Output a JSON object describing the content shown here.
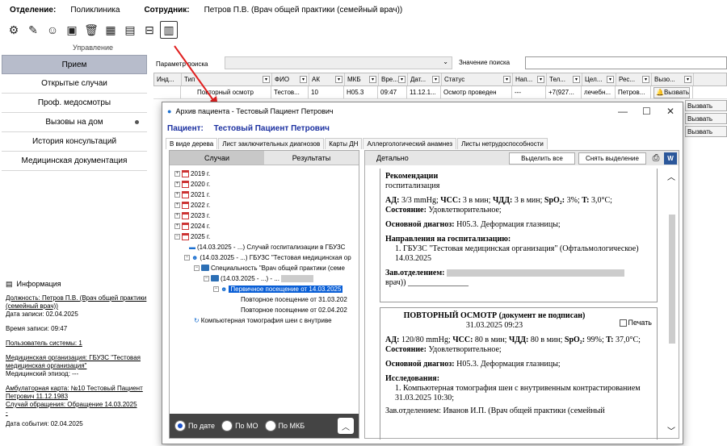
{
  "top": {
    "dept_label": "Отделение:",
    "dept_value": "Поликлиника",
    "emp_label": "Сотрудник:",
    "emp_value": "Петров П.В. (Врач общей практики (семейный врач))"
  },
  "toolbar": {
    "caption": "Управление"
  },
  "nav": [
    "Прием",
    "Открытые случаи",
    "Проф. медосмотры",
    "Вызовы на дом",
    "История консультаций",
    "Медицинская документация"
  ],
  "info": {
    "title": "Информация",
    "position": "Должность: Петров П.В. (Врач общей практики (семейный врач))",
    "record_date": "Дата записи: 02.04.2025",
    "record_time": "Время записи: 09:47",
    "sys_user": "Пользователь системы: 1",
    "org": "Медицинская организация: ГБУЗС \"Тестовая медицинская организация\"",
    "episode": "Медицинский эпизод: ---",
    "card": "Амбулаторная карта: №10 Тестовый Пациент Петрович 11.12.1983",
    "case": "Случай обращения: Обращение 14.03.2025",
    "dash": "-",
    "event_date": "Дата события: 02.04.2025"
  },
  "search": {
    "param_label": "Параметр поиска",
    "value_label": "Значение поиска"
  },
  "grid": {
    "headers": [
      "Инд...",
      "Тип",
      "ФИО",
      "АК",
      "МКБ",
      "Вре...",
      "Дат...",
      "Статус",
      "Нап...",
      "Тел...",
      "Цел...",
      "Рес...",
      "Вызо..."
    ],
    "row": [
      "",
      "Повторный осмотр",
      "Тестов...",
      "10",
      "H05.3",
      "09:47",
      "11.12.1...",
      "Осмотр проведен",
      "---",
      "+7(927...",
      "лечебн...",
      "Петров...",
      "Вызвать"
    ],
    "call_label": "Вызвать"
  },
  "modal": {
    "title": "Архив пациента - Тестовый Пациент Петрович",
    "patient_label": "Пациент:",
    "patient_name": "Тестовый Пациент Петрович",
    "tabs": [
      "В виде дерева",
      "Лист заключительных диагнозов",
      "Карты ДН",
      "Аллергологический анамнез",
      "Листы нетрудоспособности"
    ],
    "left_tabs": [
      "Случаи",
      "Результаты"
    ],
    "tree": {
      "y2019": "2019 г.",
      "y2020": "2020 г.",
      "y2021": "2021 г.",
      "y2022": "2022 г.",
      "y2023": "2023 г.",
      "y2024": "2024 г.",
      "y2025": "2025 г.",
      "n1": "(14.03.2025 - ...) Случай госпитализации в ГБУЗС",
      "n2": "(14.03.2025 - ...) ГБУЗС \"Тестовая медицинская ор",
      "n3": "Специальность \"Врач общей практики (семе",
      "n4": "(14.03.2025 - ...) - ...",
      "n5": "Первичное посещение от 14.03.2025",
      "n6": "Повторное посещение от 31.03.202",
      "n7": "Повторное посещение от 02.04.202",
      "n8": "Компьютерная томография шеи с внутриве"
    },
    "radios": [
      "По дате",
      "По МО",
      "По МКБ"
    ],
    "right_title": "Детально",
    "btn_select_all": "Выделить все",
    "btn_deselect": "Снять выделение",
    "doc1": {
      "rec_title": "Рекомендации",
      "rec_value": "госпитализация",
      "vitals_html_1": "АД:",
      "vitals_1": "3/3 mmHg;",
      "chss": "ЧСС:",
      "chss_v": "3 в мин;",
      "chdd": "ЧДД:",
      "chdd_v": "3 в мин;",
      "spo2": "SpO₂:",
      "spo2_v": "3%;",
      "t": "T:",
      "t_v": "3,0°C;",
      "state": "Состояние:",
      "state_v": "Удовлетворительное;",
      "diag": "Основной диагноз:",
      "diag_v": "H05.3. Деформация глазницы;",
      "refs": "Направления на госпитализацию:",
      "ref1": "1. ГБУЗС \"Тестовая медицинская организация\" (Офтальмологическое) 14.03.2025",
      "head": "Зав.отделением:",
      "doc_tail": "врач)) _______________"
    },
    "doc2": {
      "title": "ПОВТОРНЫЙ ОСМОТР (документ не подписан)",
      "date": "31.03.2025 09:23",
      "print": "Печать",
      "ad": "АД:",
      "ad_v": "120/80 mmHg;",
      "chss": "ЧСС:",
      "chss_v": "80 в мин;",
      "chdd": "ЧДД:",
      "chdd_v": "80 в мин;",
      "spo2": "SpO₂:",
      "spo2_v": "99%;",
      "t": "T:",
      "t_v": "37,0°C;",
      "state": "Состояние:",
      "state_v": "Удовлетворительное;",
      "diag": "Основной диагноз:",
      "diag_v": "H05.3. Деформация глазницы;",
      "research": "Исследования:",
      "r1": "1. Компьютерная томография шеи с внутривенным контрастированием 31.03.2025 10:30;",
      "tail": "Зав.отделением: Иванов И.П. (Врач общей практики (семейный"
    }
  }
}
